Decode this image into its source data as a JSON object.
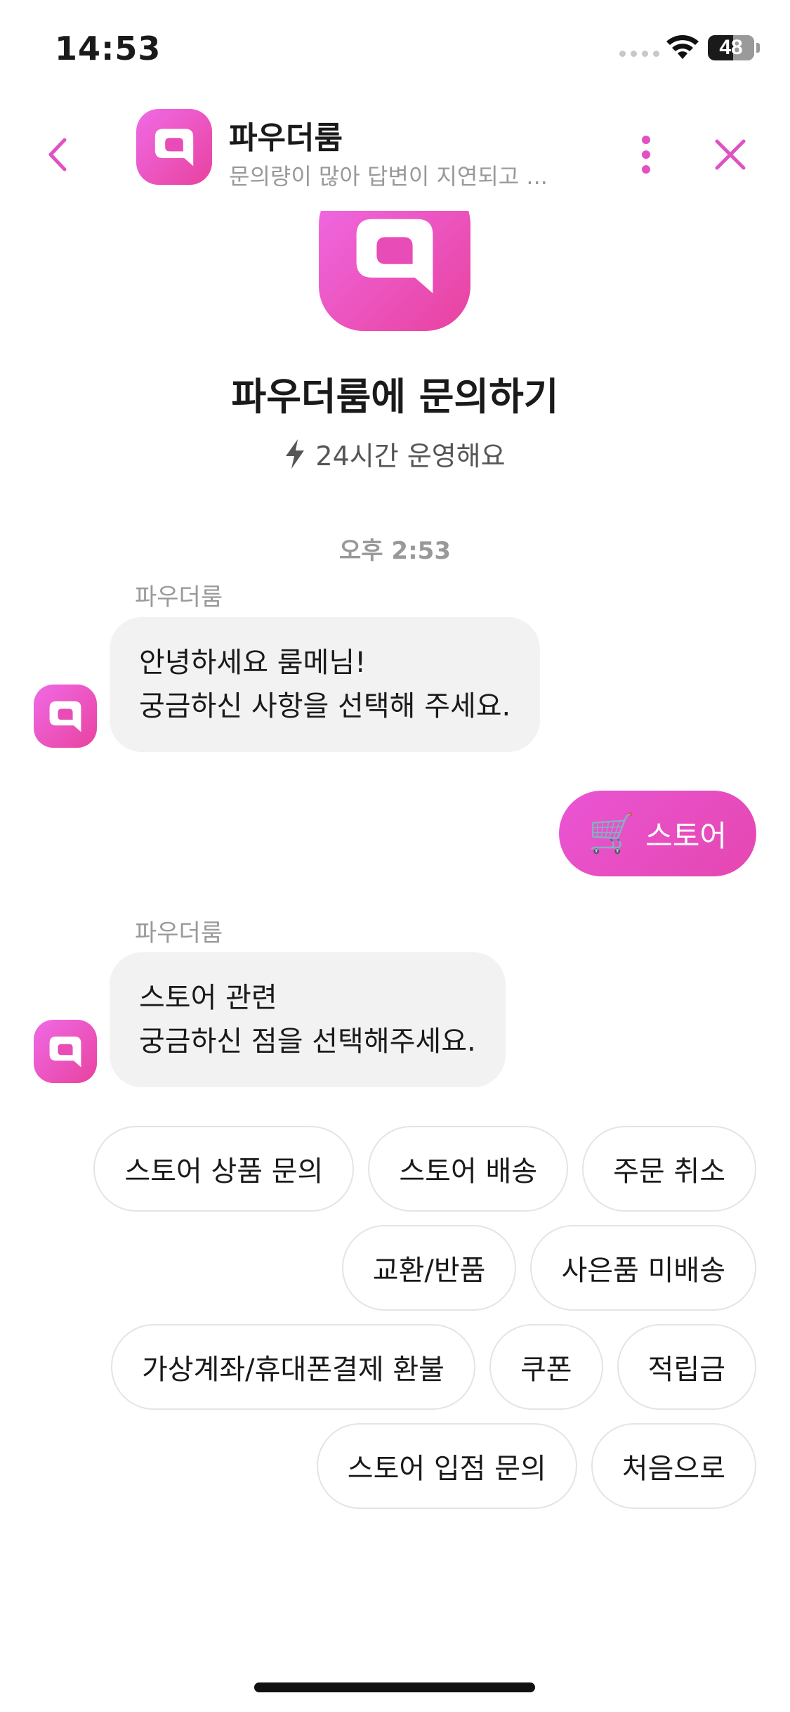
{
  "status_bar": {
    "time": "14:53",
    "battery": "48"
  },
  "header": {
    "title": "파우더룸",
    "subtitle": "문의량이 많아 답변이 지연되고 ..."
  },
  "intro": {
    "title": "파우더룸에 문의하기",
    "hours": "24시간 운영해요"
  },
  "chat": {
    "timestamp": "오후 2:53",
    "messages": [
      {
        "sender": "파우더룸",
        "lines": [
          "안녕하세요 룸메님!",
          "궁금하신 사항을 선택해 주세요."
        ]
      },
      {
        "user_reply": {
          "emoji": "🛒",
          "label": "스토어"
        }
      },
      {
        "sender": "파우더룸",
        "lines": [
          "스토어 관련",
          "궁금하신 점을 선택해주세요."
        ]
      }
    ]
  },
  "quick_replies": [
    [
      "스토어 상품 문의",
      "스토어 배송",
      "주문 취소"
    ],
    [
      "교환/반품",
      "사은품 미배송"
    ],
    [
      "가상계좌/휴대폰결제 환불",
      "쿠폰",
      "적립금"
    ],
    [
      "스토어 입점 문의",
      "처음으로"
    ]
  ],
  "colors": {
    "accent": "#e547b0",
    "accent_light": "#f06ae6",
    "bubble_bg": "#f2f2f2",
    "muted_text": "#999999"
  },
  "icons": {
    "back": "chevron-left-icon",
    "more": "more-vertical-icon",
    "close": "close-icon",
    "hours": "lightning-icon",
    "logo": "speech-bubble-logo-icon"
  }
}
